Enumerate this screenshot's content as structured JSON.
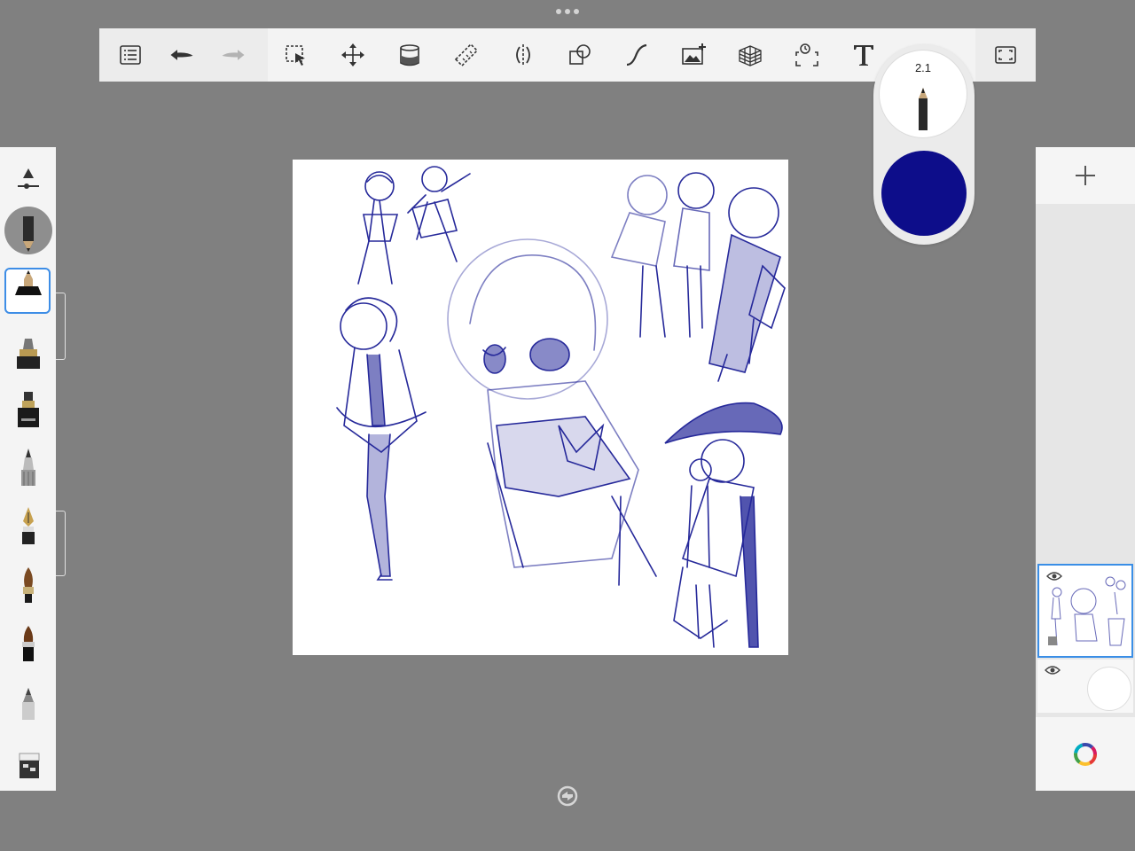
{
  "app": {
    "overflow_menu_icon": "three-dots-icon"
  },
  "toolbar": {
    "left_tools": [
      {
        "name": "layers-list",
        "icon": "list-icon"
      },
      {
        "name": "undo",
        "icon": "undo-arrow-icon"
      },
      {
        "name": "redo",
        "icon": "redo-arrow-icon"
      }
    ],
    "tools": [
      {
        "name": "selection",
        "icon": "selection-icon"
      },
      {
        "name": "transform",
        "icon": "move-icon"
      },
      {
        "name": "fill",
        "icon": "fill-bucket-icon"
      },
      {
        "name": "ruler",
        "icon": "ruler-icon"
      },
      {
        "name": "symmetry",
        "icon": "symmetry-icon"
      },
      {
        "name": "shapes",
        "icon": "shapes-icon"
      },
      {
        "name": "curve",
        "icon": "curve-icon"
      },
      {
        "name": "add-image",
        "icon": "add-image-icon"
      },
      {
        "name": "perspective",
        "icon": "perspective-grid-icon"
      },
      {
        "name": "time-lapse",
        "icon": "time-lapse-icon"
      },
      {
        "name": "text",
        "icon": "text-icon",
        "label": "T"
      }
    ],
    "right_tools": [
      {
        "name": "fullscreen",
        "icon": "fullscreen-icon"
      }
    ]
  },
  "brush_puck": {
    "size": "2.1",
    "color": "#0d0d8a"
  },
  "brushes": [
    "brush-settings",
    "pencil-preview",
    "pencil",
    "marker",
    "ink-pen",
    "ballpoint",
    "fountain-pen",
    "paintbrush",
    "chisel-brush",
    "airbrush",
    "eraser"
  ],
  "layers": {
    "add_icon": "plus-icon",
    "items": [
      {
        "name": "sketch-layer",
        "visible": true,
        "active": true
      },
      {
        "name": "background-layer",
        "visible": true,
        "active": false
      }
    ]
  },
  "colors": {
    "ink": "#26299a",
    "accent": "#3d8de6"
  }
}
